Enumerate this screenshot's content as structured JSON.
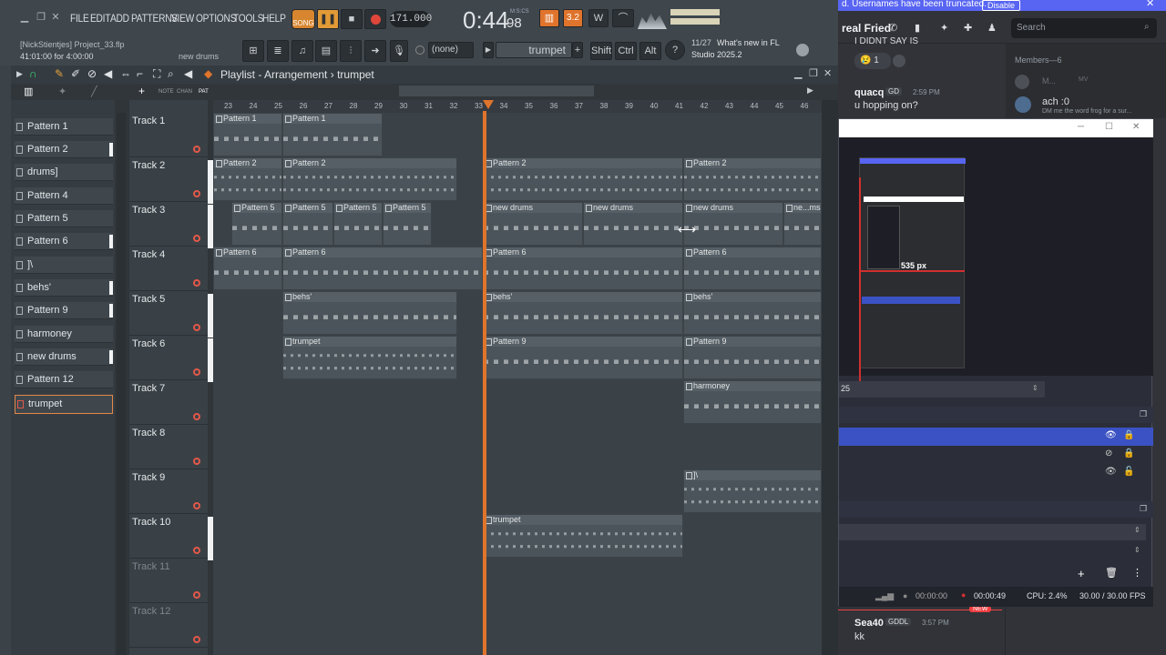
{
  "menu": [
    "FILE",
    "EDIT",
    "ADD",
    "PATTERNS",
    "VIEW",
    "OPTIONS",
    "TOOLS",
    "HELP"
  ],
  "transport": {
    "mode": "SONG",
    "tempo": "171.000",
    "time": "0:44",
    "time_sub": "98",
    "time_unit": "M:S:CS",
    "step": "3.2"
  },
  "project": {
    "user_file": "[NickStientjes] Project_33.flp",
    "position": "41:01:00 for 4:00:00",
    "hint": "new drums"
  },
  "toolbar": {
    "channel_none": "(none)",
    "pattern": "trumpet",
    "shift": "Shift",
    "ctrl": "Ctrl",
    "alt": "Alt",
    "news_count": "11/27",
    "news_text": "What's new in FL",
    "news_version": "Studio 2025.2"
  },
  "playlist": {
    "title": "Playlist - Arrangement",
    "pattern": "trumpet",
    "sub_labels": [
      "NOTE",
      "CHAN",
      "PAT"
    ]
  },
  "ruler": [
    "23",
    "24",
    "25",
    "26",
    "27",
    "28",
    "29",
    "30",
    "31",
    "32",
    "33",
    "34",
    "35",
    "36",
    "37",
    "38",
    "39",
    "40",
    "41",
    "42",
    "43",
    "44",
    "45",
    "46"
  ],
  "picker": [
    "Pattern 1",
    "Pattern 2",
    "drums]",
    "Pattern 4",
    "Pattern 5",
    "Pattern 6",
    "]\\",
    "behs'",
    "Pattern 9",
    "harmoney",
    "new drums",
    "Pattern 12",
    "trumpet"
  ],
  "tracks": [
    "Track 1",
    "Track 2",
    "Track 3",
    "Track 4",
    "Track 5",
    "Track 6",
    "Track 7",
    "Track 8",
    "Track 9",
    "Track 10",
    "Track 11",
    "Track 12"
  ],
  "clips": {
    "p1": "Pattern 1",
    "p2": "Pattern 2",
    "p5": "Pattern 5",
    "nd": "new drums",
    "nd_short": "ne...ms",
    "p6": "Pattern 6",
    "behs": "behs'",
    "trumpet": "trumpet",
    "p9": "Pattern 9",
    "harmoney": "harmoney",
    "bs": "]\\"
  },
  "discord": {
    "banner": "d. Usernames have been truncated.",
    "disable": "Disable",
    "server": "real Fried",
    "search_placeholder": "Search",
    "top_msg": "I DIDNT SAY IS",
    "reaction_count": "1",
    "msg1_user": "quacq",
    "msg1_tag": "GD",
    "msg1_time": "2:59 PM",
    "msg1_text": "u hopping on?",
    "members_header": "Members—6",
    "member1": "M...",
    "member1_tag": "MV",
    "member2": "ach :0",
    "member2_status": "DM me the word frog for a sur...",
    "msg2_user": "Sea40",
    "msg2_tag": "GDDL",
    "msg2_time": "3:57 PM",
    "msg2_text": "kk",
    "new_label": "NEW"
  },
  "obs": {
    "preview_measure": "535 px",
    "field_value": "25",
    "rec_time": "00:00:00",
    "stream_time": "00:00:49",
    "cpu": "CPU: 2.4%",
    "fps": "30.00 / 30.00 FPS"
  },
  "colors": {
    "accent_orange": "#e0742c",
    "discord_blurple": "#5865f2",
    "obs_selected": "#3b52c4",
    "obs_red": "#d12f2f"
  }
}
